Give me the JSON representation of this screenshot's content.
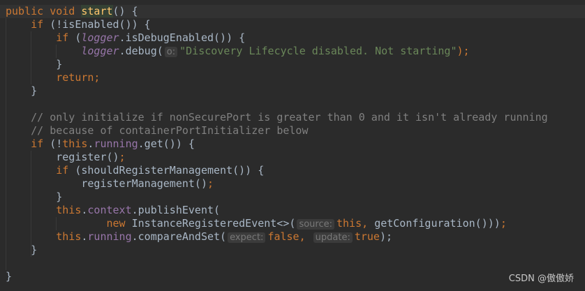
{
  "colors": {
    "background": "#2b2b2b",
    "keyword": "#cc7832",
    "plain": "#a9b7c6",
    "field": "#9876aa",
    "string": "#6a8759",
    "comment": "#808080"
  },
  "code": [
    [
      {
        "t": "public void ",
        "c": "kw"
      },
      {
        "t": "start",
        "c": "hl"
      },
      {
        "t": "() {",
        "c": "pl"
      }
    ],
    [
      {
        "t": "    "
      },
      {
        "t": "if",
        "c": "kw"
      },
      {
        "t": " (!isEnabled()) {",
        "c": "pl"
      }
    ],
    [
      {
        "t": "        "
      },
      {
        "t": "if",
        "c": "kw"
      },
      {
        "t": " (",
        "c": "pl"
      },
      {
        "t": "logger",
        "c": "fldi"
      },
      {
        "t": ".isDebugEnabled()) {",
        "c": "pl"
      }
    ],
    [
      {
        "t": "            "
      },
      {
        "t": "logger",
        "c": "fldi"
      },
      {
        "t": ".debug(",
        "c": "pl"
      },
      {
        "t": "o:",
        "c": "hint"
      },
      {
        "t": "\"Discovery Lifecycle disabled. Not starting\"",
        "c": "str"
      },
      {
        "t": ");",
        "c": "kw"
      }
    ],
    [
      {
        "t": "        }",
        "c": "pl"
      }
    ],
    [
      {
        "t": "        "
      },
      {
        "t": "return;",
        "c": "kw"
      }
    ],
    [
      {
        "t": "    }",
        "c": "pl"
      }
    ],
    [],
    [
      {
        "t": "    "
      },
      {
        "t": "// only initialize if nonSecurePort is greater than 0 and it isn't already running",
        "c": "cm"
      }
    ],
    [
      {
        "t": "    "
      },
      {
        "t": "// because of containerPortInitializer below",
        "c": "cm"
      }
    ],
    [
      {
        "t": "    "
      },
      {
        "t": "if",
        "c": "kw"
      },
      {
        "t": " (!",
        "c": "pl"
      },
      {
        "t": "this",
        "c": "kw"
      },
      {
        "t": ".",
        "c": "pl"
      },
      {
        "t": "running",
        "c": "fld"
      },
      {
        "t": ".get()) {",
        "c": "pl"
      }
    ],
    [
      {
        "t": "        register()",
        "c": "pl"
      },
      {
        "t": ";",
        "c": "kw"
      }
    ],
    [
      {
        "t": "        "
      },
      {
        "t": "if",
        "c": "kw"
      },
      {
        "t": " (shouldRegisterManagement()) {",
        "c": "pl"
      }
    ],
    [
      {
        "t": "            registerManagement()",
        "c": "pl"
      },
      {
        "t": ";",
        "c": "kw"
      }
    ],
    [
      {
        "t": "        }",
        "c": "pl"
      }
    ],
    [
      {
        "t": "        "
      },
      {
        "t": "this",
        "c": "kw"
      },
      {
        "t": ".",
        "c": "pl"
      },
      {
        "t": "context",
        "c": "fld"
      },
      {
        "t": ".publishEvent(",
        "c": "pl"
      }
    ],
    [
      {
        "t": "                "
      },
      {
        "t": "new",
        "c": "kw"
      },
      {
        "t": " InstanceRegisteredEvent<>(",
        "c": "pl"
      },
      {
        "t": "source:",
        "c": "hint"
      },
      {
        "t": "this",
        "c": "kw"
      },
      {
        "t": ", ",
        "c": "kw"
      },
      {
        "t": "getConfiguration()))",
        "c": "pl"
      },
      {
        "t": ";",
        "c": "kw"
      }
    ],
    [
      {
        "t": "        "
      },
      {
        "t": "this",
        "c": "kw"
      },
      {
        "t": ".",
        "c": "pl"
      },
      {
        "t": "running",
        "c": "fld"
      },
      {
        "t": ".compareAndSet(",
        "c": "pl"
      },
      {
        "t": "expect:",
        "c": "hint"
      },
      {
        "t": "false, ",
        "c": "kw"
      },
      {
        "t": "update:",
        "c": "hint"
      },
      {
        "t": "true",
        "c": "kw"
      },
      {
        "t": ");",
        "c": "pl"
      }
    ],
    [
      {
        "t": "    }",
        "c": "pl"
      }
    ],
    [],
    [
      {
        "t": "}",
        "c": "pl"
      }
    ]
  ],
  "watermark": "CSDN @傲傲娇"
}
